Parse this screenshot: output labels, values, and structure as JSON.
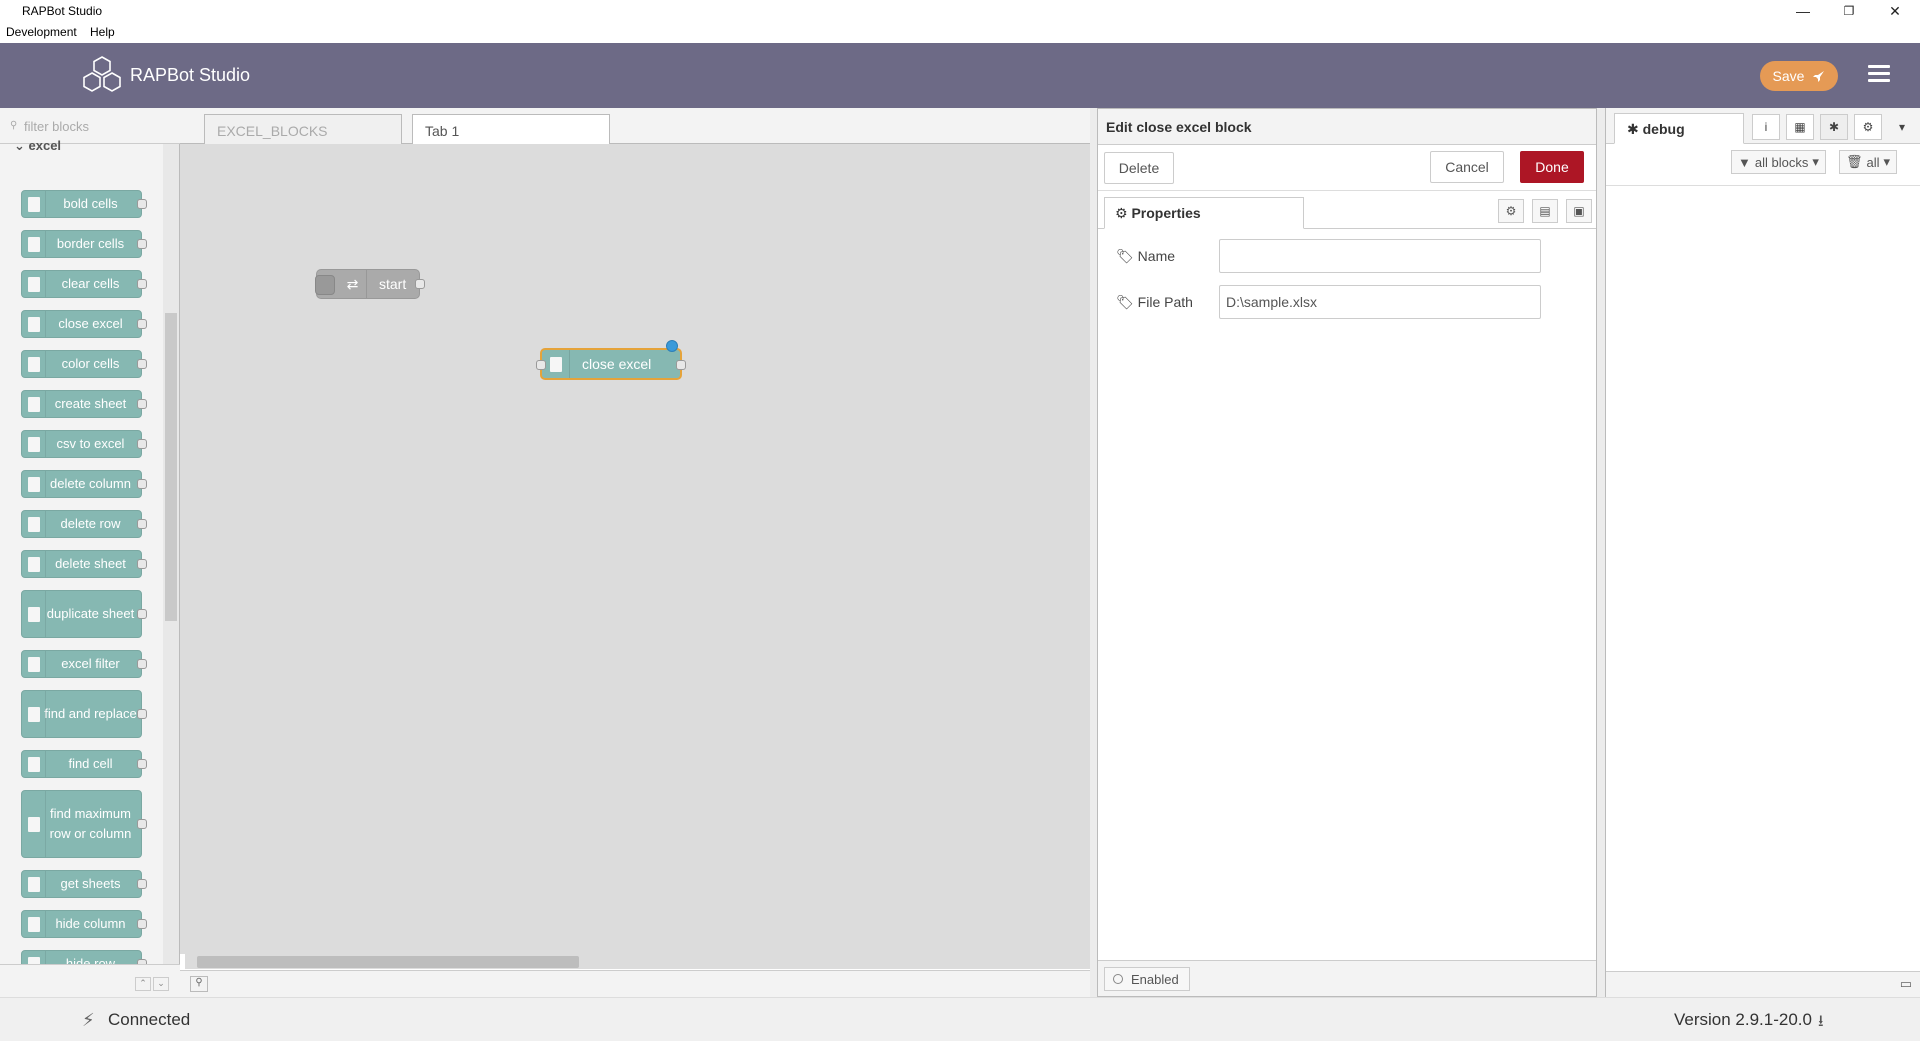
{
  "window": {
    "title": "RAPBot Studio",
    "controls": {
      "minimize": "—",
      "restore": "❐",
      "close": "✕"
    }
  },
  "menubar": {
    "items": [
      "Development",
      "Help"
    ]
  },
  "header": {
    "brand": "RAPBot Studio",
    "save_label": "Save"
  },
  "palette": {
    "filter_placeholder": "filter blocks",
    "category": "excel",
    "blocks": [
      "bold cells",
      "border cells",
      "clear cells",
      "close excel",
      "color cells",
      "create sheet",
      "csv to excel",
      "delete column",
      "delete row",
      "delete sheet",
      "duplicate sheet",
      "excel filter",
      "find and replace",
      "find cell",
      "find maximum row or column",
      "get sheets",
      "hide column",
      "hide row"
    ]
  },
  "workspace": {
    "tabs": [
      {
        "label": "EXCEL_BLOCKS",
        "active": false
      },
      {
        "label": "Tab 1",
        "active": true
      }
    ],
    "nodes": [
      {
        "label": "start",
        "type": "inject"
      },
      {
        "label": "close excel",
        "type": "excel",
        "selected": true
      }
    ]
  },
  "editor": {
    "title": "Edit close excel block",
    "delete_label": "Delete",
    "cancel_label": "Cancel",
    "done_label": "Done",
    "properties_tab": "Properties",
    "fields": {
      "name": {
        "label": "Name",
        "value": ""
      },
      "file_path": {
        "label": "File Path",
        "value": "D:\\sample.xlsx"
      }
    },
    "enabled_label": "Enabled"
  },
  "sidebar": {
    "active_tab": "debug",
    "filter_label": "all blocks",
    "clear_label": "all"
  },
  "statusbar": {
    "connection": "Connected",
    "version": "Version 2.9.1-20.0"
  },
  "colors": {
    "header": "#6d6a86",
    "save_button": "#e59a55",
    "done_button": "#ad1625",
    "block": "#86b8b2",
    "selected_outline": "#e5a33a"
  }
}
